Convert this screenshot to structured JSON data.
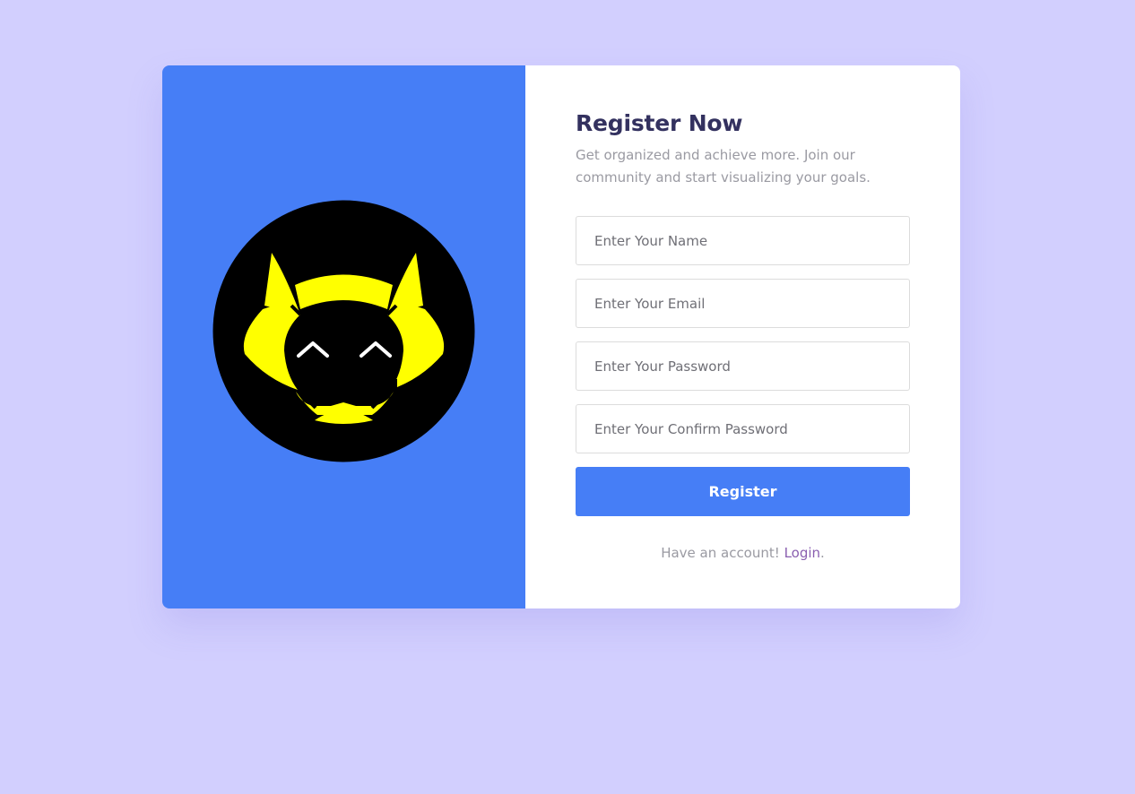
{
  "colors": {
    "background": "#d2cffe",
    "accent": "#467ef6",
    "title": "#33315f",
    "link": "#8a5fb0",
    "logo_yellow": "#ffff00",
    "logo_black": "#000000"
  },
  "logo": {
    "icon": "cat-face-logo-icon"
  },
  "form": {
    "title": "Register Now",
    "subtitle": "Get organized and achieve more. Join our community and start visualizing your goals.",
    "name_placeholder": "Enter Your Name",
    "email_placeholder": "Enter Your Email",
    "password_placeholder": "Enter Your Password",
    "confirm_password_placeholder": "Enter Your Confirm Password",
    "submit_label": "Register",
    "footer_text": "Have an account!",
    "login_label": "Login",
    "footer_end": "."
  }
}
